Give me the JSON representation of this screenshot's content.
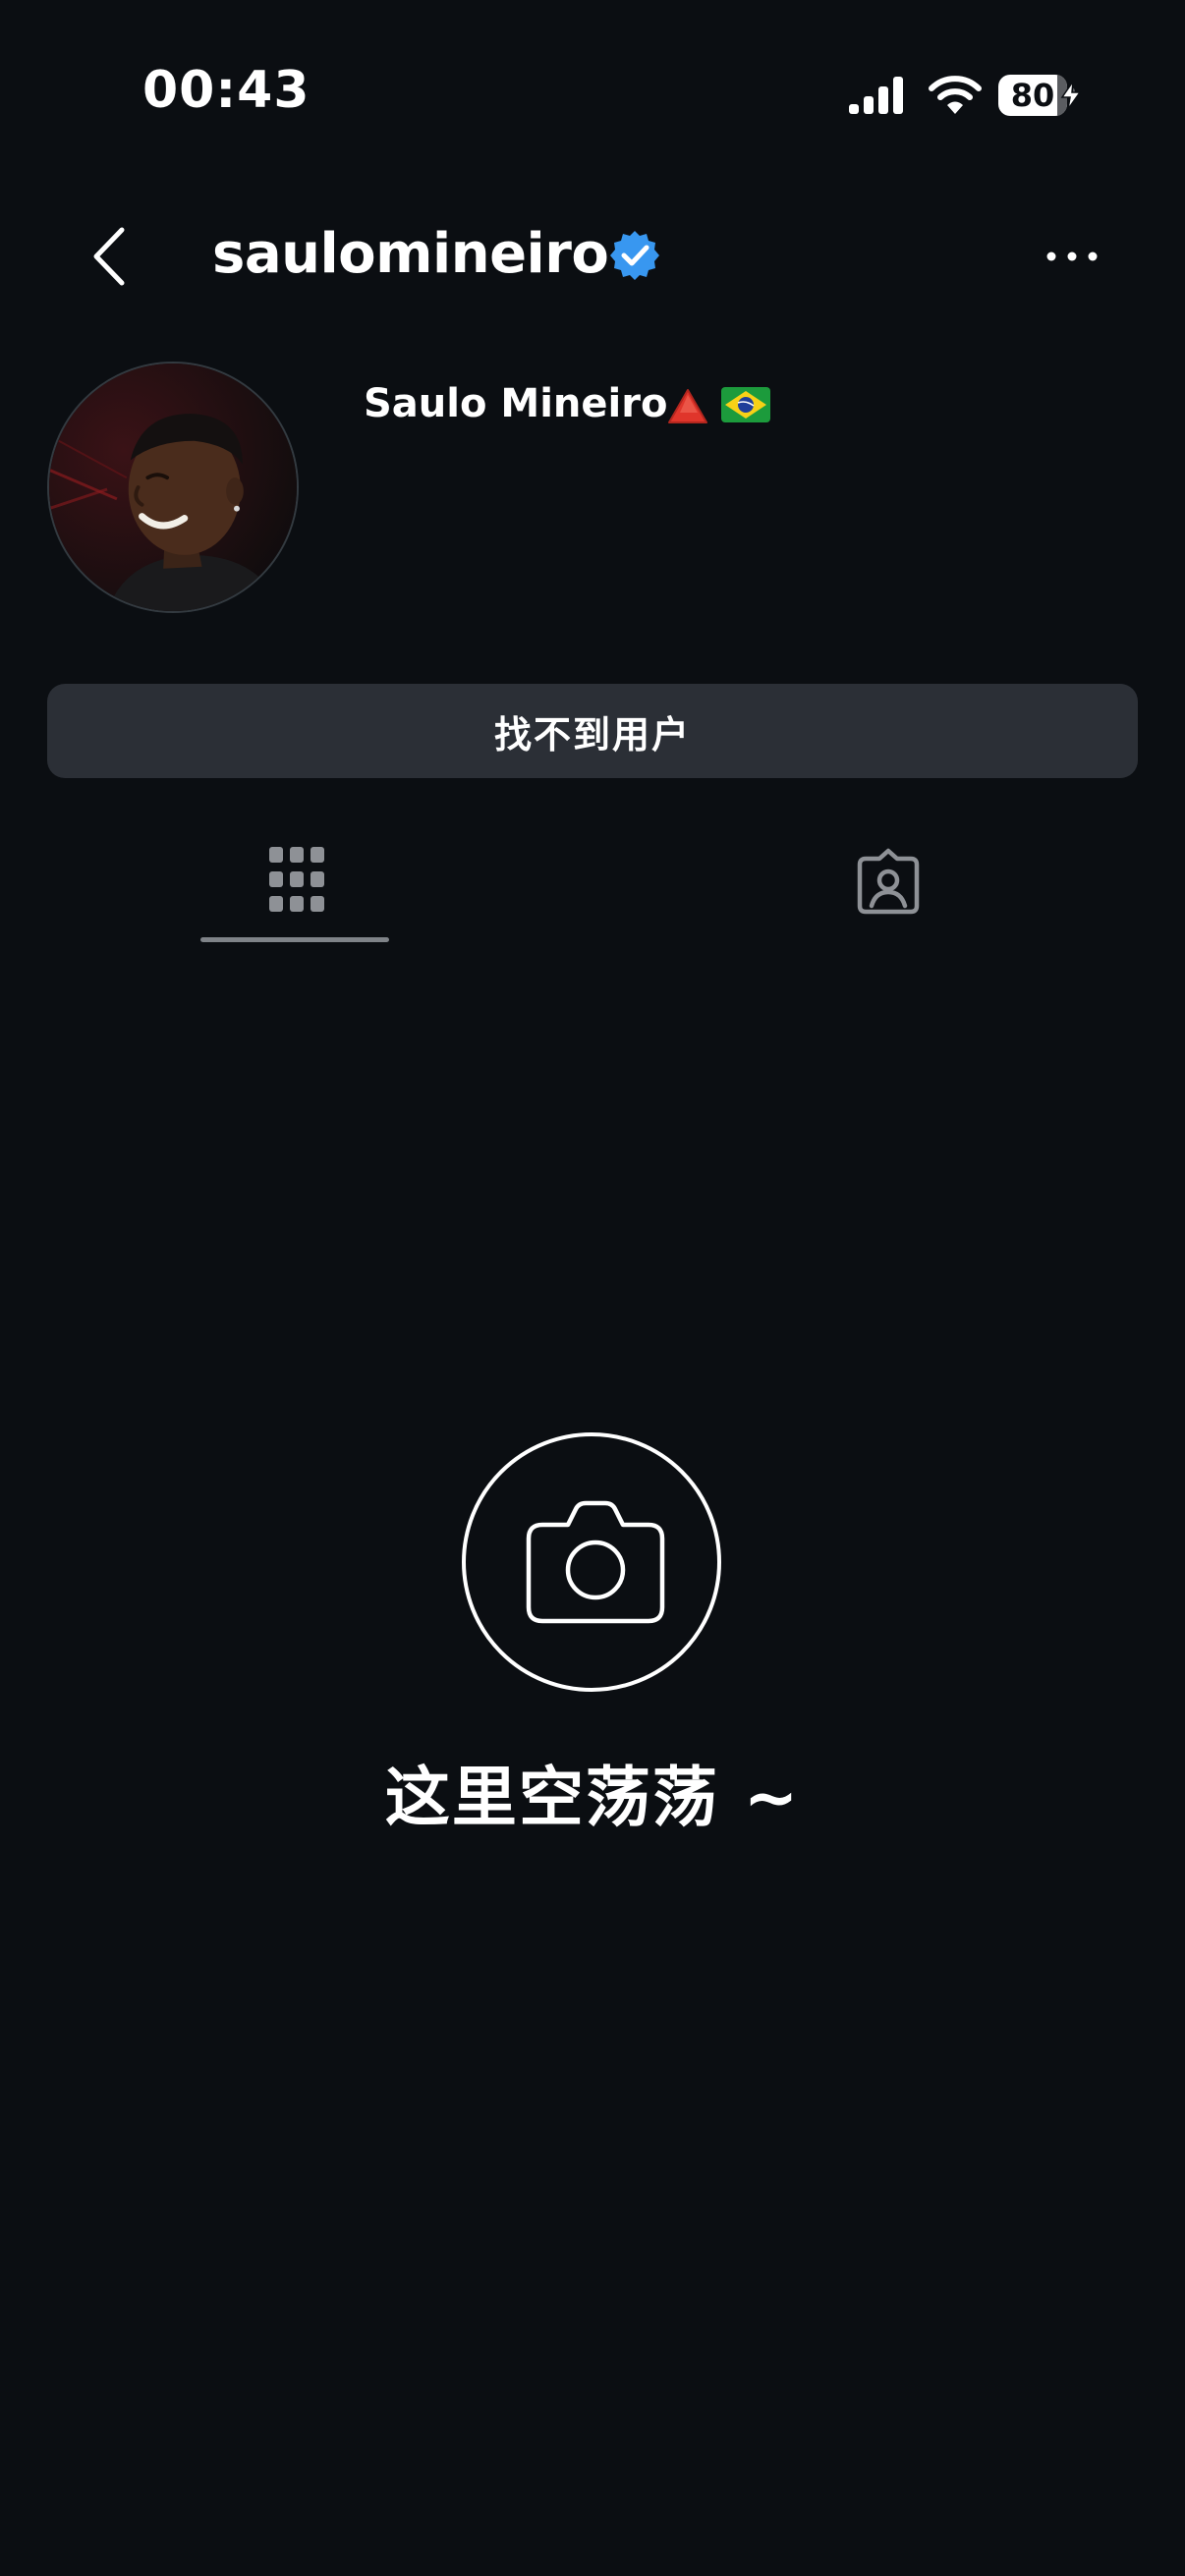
{
  "status_bar": {
    "time": "00:43",
    "battery_level": "80",
    "signal_icon": "cellular-signal-icon",
    "wifi_icon": "wifi-icon",
    "charging_icon": "bolt-icon"
  },
  "header": {
    "username": "saulomineiro",
    "verified_icon": "verified-badge-icon",
    "back_icon": "chevron-left-icon",
    "more_icon": "more-horizontal-icon"
  },
  "profile": {
    "display_name": "Saulo Mineiro",
    "name_emojis": [
      "red-triangle-icon",
      "brazil-flag-icon"
    ],
    "avatar": "profile-photo"
  },
  "action_button": {
    "label": "找不到用户"
  },
  "tabs": [
    {
      "name": "posts-grid",
      "icon": "grid-icon",
      "selected": true
    },
    {
      "name": "tagged",
      "icon": "tagged-person-icon",
      "selected": false
    }
  ],
  "empty_state": {
    "icon": "camera-icon",
    "message": "这里空荡荡 ~"
  },
  "colors": {
    "background": "#0b0e12",
    "button_background": "#2b2f36",
    "verified_blue": "#3897f0",
    "tab_icon_gray": "#8e9196"
  }
}
